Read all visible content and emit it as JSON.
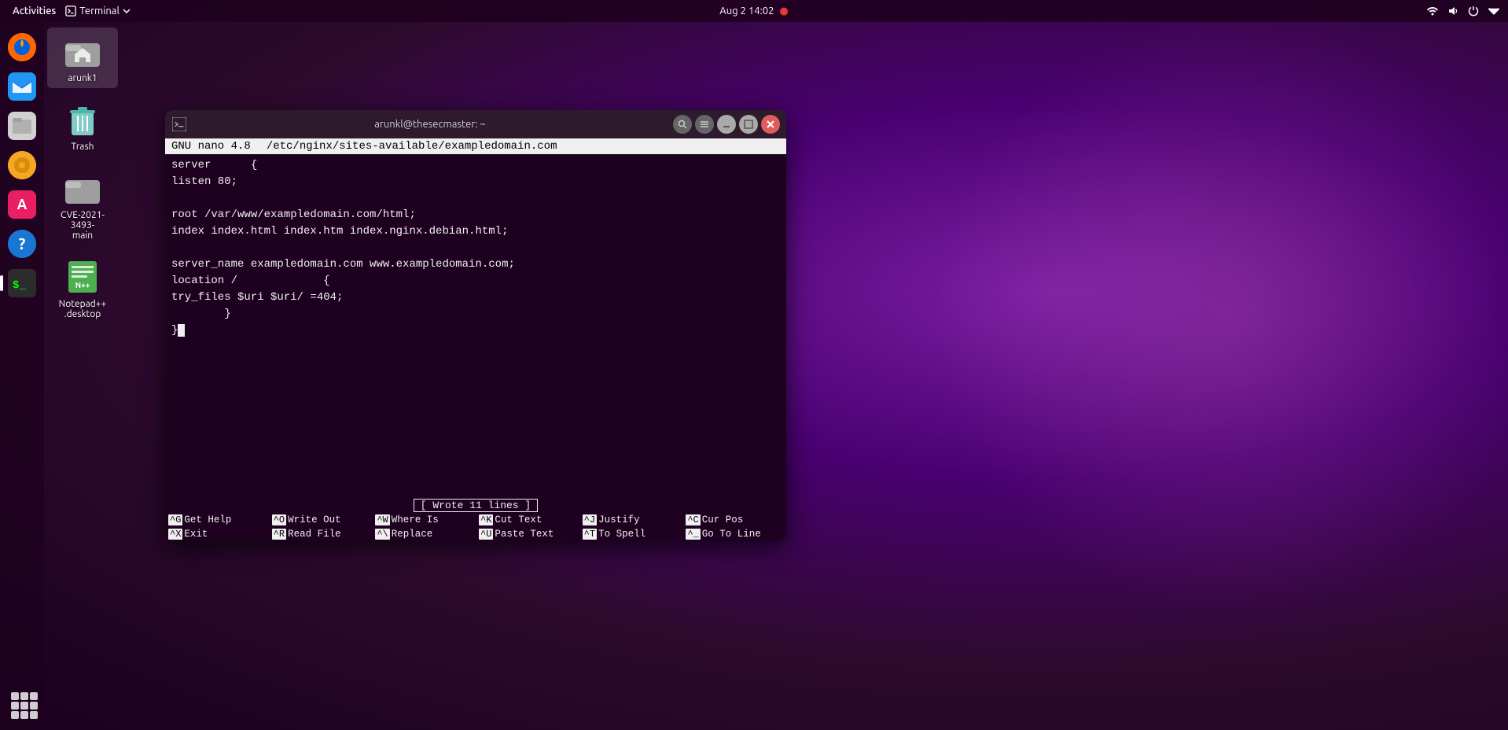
{
  "topbar": {
    "activities": "Activities",
    "terminal_label": "Terminal",
    "datetime": "Aug 2  14:02",
    "recording_indicator": "●"
  },
  "dock": {
    "icons": [
      {
        "name": "firefox",
        "label": "Firefox"
      },
      {
        "name": "email",
        "label": "Thunderbird"
      },
      {
        "name": "files",
        "label": "Files"
      },
      {
        "name": "rhythmbox",
        "label": "Rhythmbox"
      },
      {
        "name": "software",
        "label": "Software"
      },
      {
        "name": "help",
        "label": "Help"
      },
      {
        "name": "terminal",
        "label": "Terminal"
      }
    ]
  },
  "desktop_icons": [
    {
      "id": "arunk1",
      "label": "arunk1",
      "type": "home"
    },
    {
      "id": "trash",
      "label": "Trash",
      "type": "trash"
    },
    {
      "id": "cve",
      "label": "CVE-2021-3493-\nmain",
      "type": "folder"
    },
    {
      "id": "notepad",
      "label": "Notepad++\n.desktop",
      "type": "desktop_file"
    }
  ],
  "terminal": {
    "title": "arunkl@thesecmaster: ~",
    "nano_version": "GNU nano 4.8",
    "file_path": "/etc/nginx/sites-available/exampledomain.com",
    "content_lines": [
      "server      {",
      "listen 80;",
      "",
      "root /var/www/exampledomain.com/html;",
      "index index.html index.htm index.nginx.debian.html;",
      "",
      "server_name exampledomain.com www.exampledomain.com;",
      "location /             {",
      "try_files $uri $uri/ =404;",
      "        }",
      "}"
    ],
    "status_message": "[ Wrote 11 lines ]",
    "shortcuts": [
      {
        "key": "^G",
        "label": "Get Help"
      },
      {
        "key": "^O",
        "label": "Write Out"
      },
      {
        "key": "^W",
        "label": "Where Is"
      },
      {
        "key": "^K",
        "label": "Cut Text"
      },
      {
        "key": "^J",
        "label": "Justify"
      },
      {
        "key": "^C",
        "label": "Cur Pos"
      },
      {
        "key": "^X",
        "label": "Exit"
      },
      {
        "key": "^R",
        "label": "Read File"
      },
      {
        "key": "^\\",
        "label": "Replace"
      },
      {
        "key": "^U",
        "label": "Paste Text"
      },
      {
        "key": "^T",
        "label": "To Spell"
      },
      {
        "key": "^_",
        "label": "Go To Line"
      }
    ]
  }
}
